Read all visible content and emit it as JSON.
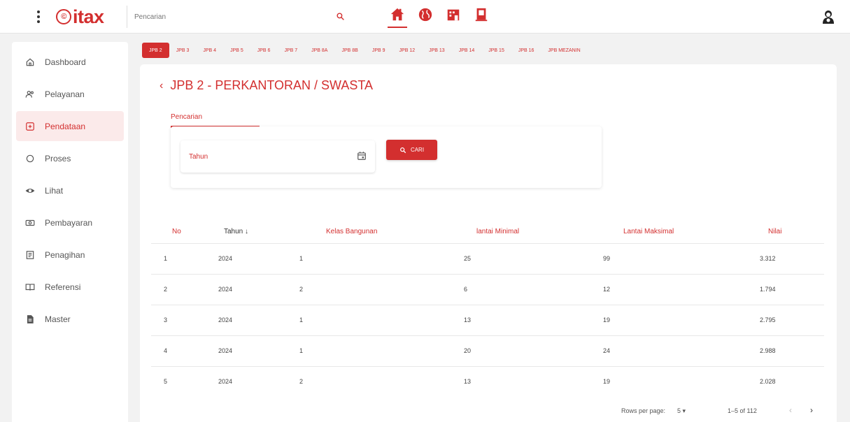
{
  "header": {
    "logo_text": "itax",
    "logo_circle": "©",
    "search_placeholder": "Pencarian"
  },
  "sidebar": {
    "items": [
      {
        "label": "Dashboard",
        "icon": "home-icon"
      },
      {
        "label": "Pelayanan",
        "icon": "users-icon"
      },
      {
        "label": "Pendataan",
        "icon": "plus-box-icon"
      },
      {
        "label": "Proses",
        "icon": "circle-icon"
      },
      {
        "label": "Lihat",
        "icon": "eye-icon"
      },
      {
        "label": "Pembayaran",
        "icon": "cash-icon"
      },
      {
        "label": "Penagihan",
        "icon": "document-icon"
      },
      {
        "label": "Referensi",
        "icon": "book-icon"
      },
      {
        "label": "Master",
        "icon": "file-icon"
      }
    ],
    "active": 2
  },
  "tabs": [
    "JPB 2",
    "JPB 3",
    "JPB 4",
    "JPB 5",
    "JPB 6",
    "JPB 7",
    "JPB 8A",
    "JPB 8B",
    "JPB 9",
    "JPB 12",
    "JPB 13",
    "JPB 14",
    "JPB 15",
    "JPB 16",
    "JPB MEZANIN"
  ],
  "page": {
    "back_symbol": "‹",
    "title": "JPB 2 - PERKANTORAN / SWASTA",
    "panel_tab": "Pencarian",
    "year_label": "Tahun",
    "search_button": "CARI"
  },
  "table": {
    "headers": {
      "no": "No",
      "tahun": "Tahun ↓",
      "kelas": "Kelas Bangunan",
      "lmin": "lantai Minimal",
      "lmax": "Lantai Maksimal",
      "nilai": "Nilai"
    },
    "rows": [
      {
        "no": "1",
        "tahun": "2024",
        "kelas": "1",
        "lmin": "25",
        "lmax": "99",
        "nilai": "3.312"
      },
      {
        "no": "2",
        "tahun": "2024",
        "kelas": "2",
        "lmin": "6",
        "lmax": "12",
        "nilai": "1.794"
      },
      {
        "no": "3",
        "tahun": "2024",
        "kelas": "1",
        "lmin": "13",
        "lmax": "19",
        "nilai": "2.795"
      },
      {
        "no": "4",
        "tahun": "2024",
        "kelas": "1",
        "lmin": "20",
        "lmax": "24",
        "nilai": "2.988"
      },
      {
        "no": "5",
        "tahun": "2024",
        "kelas": "2",
        "lmin": "13",
        "lmax": "19",
        "nilai": "2.028"
      }
    ]
  },
  "pagination": {
    "rows_per_page_label": "Rows per page:",
    "rows_per_page_value": "5",
    "range": "1–5 of 112",
    "prev": "‹",
    "next": "›"
  },
  "colors": {
    "accent": "#d32f2f"
  }
}
